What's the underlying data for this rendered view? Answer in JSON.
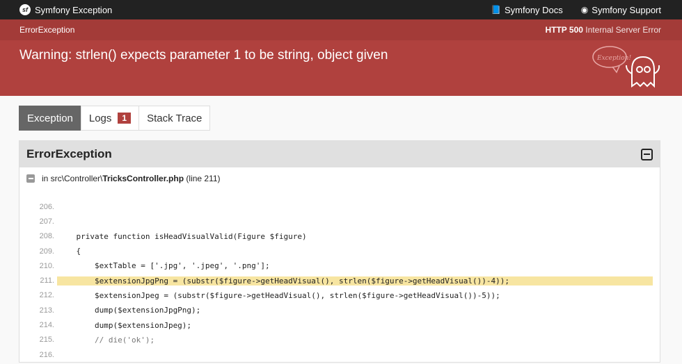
{
  "topbar": {
    "brand": "Symfony Exception",
    "docs": "Symfony Docs",
    "support": "Symfony Support"
  },
  "header": {
    "class": "ErrorException",
    "status_code": "HTTP 500",
    "status_text": "Internal Server Error",
    "message": "Warning: strlen() expects parameter 1 to be string, object given",
    "ghost_text": "Exception!"
  },
  "tabs": [
    {
      "label": "Exception"
    },
    {
      "label": "Logs",
      "badge": "1"
    },
    {
      "label": "Stack Trace"
    }
  ],
  "trace": {
    "title": "ErrorException",
    "file_prefix": "in src\\Controller\\",
    "file_name": "TricksController.php",
    "file_line": "(line 211)",
    "lines": [
      {
        "num": "206.",
        "code": ""
      },
      {
        "num": "207.",
        "code": ""
      },
      {
        "num": "208.",
        "code": "    private function isHeadVisualValid(Figure $figure)"
      },
      {
        "num": "209.",
        "code": "    {"
      },
      {
        "num": "210.",
        "code": "        $extTable = ['.jpg', '.jpeg', '.png'];"
      },
      {
        "num": "211.",
        "code": "        $extensionJpgPng = (substr($figure->getHeadVisual(), strlen($figure->getHeadVisual())-4));"
      },
      {
        "num": "212.",
        "code": "        $extensionJpeg = (substr($figure->getHeadVisual(), strlen($figure->getHeadVisual())-5));"
      },
      {
        "num": "213.",
        "code": "        dump($extensionJpgPng);"
      },
      {
        "num": "214.",
        "code": "        dump($extensionJpeg);"
      },
      {
        "num": "215.",
        "code": "        // die('ok');"
      },
      {
        "num": "216.",
        "code": ""
      }
    ]
  }
}
